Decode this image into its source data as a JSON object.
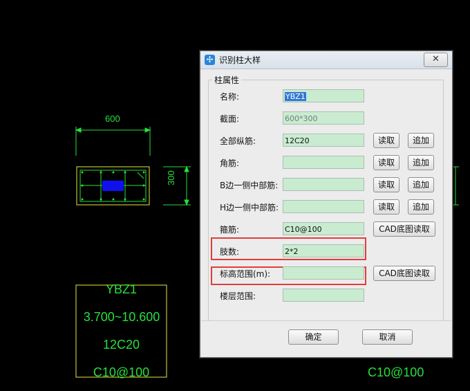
{
  "cad": {
    "dim_top": "600",
    "dim_right": "300",
    "annot": [
      "YBZ1",
      "3.700~10.600",
      "12C20",
      "C10@100"
    ],
    "annot_right": "C10@100"
  },
  "dialog": {
    "title": "识别柱大样",
    "close_glyph": "✕",
    "group_title": "柱属性",
    "rows": [
      {
        "label": "名称:",
        "value": "YBZ1"
      },
      {
        "label": "截面:",
        "value": "600*300"
      },
      {
        "label": "全部纵筋:",
        "value": "12C20"
      },
      {
        "label": "角筋:",
        "value": ""
      },
      {
        "label": "B边一侧中部筋:",
        "value": ""
      },
      {
        "label": "H边一侧中部筋:",
        "value": ""
      },
      {
        "label": "箍筋:",
        "value": "C10@100"
      },
      {
        "label": "肢数:",
        "value": "2*2"
      },
      {
        "label": "标高范围(m):",
        "value": ""
      },
      {
        "label": "楼层范围:",
        "value": ""
      }
    ],
    "read_label": "读取",
    "append_label": "追加",
    "cad_read_label": "CAD底图读取",
    "ok_label": "确定",
    "cancel_label": "取消"
  },
  "colors": {
    "cad_green": "#27e03c",
    "cad_yellow": "#e8e83a",
    "highlight_red": "#e53b3b",
    "field_green": "#c9ecd1"
  }
}
